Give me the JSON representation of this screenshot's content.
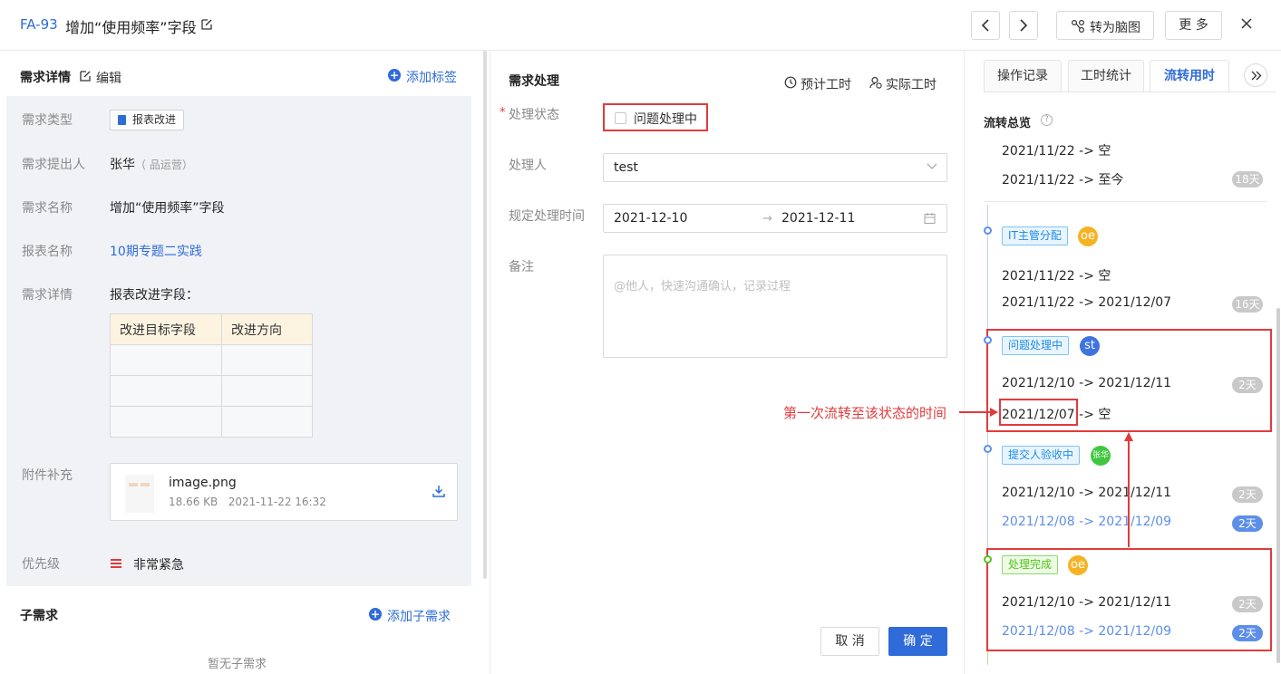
{
  "header": {
    "id": "FA-93",
    "title": "增加“使用频率”字段",
    "mind_map_label": "转为脑图",
    "more_label": "更 多"
  },
  "left": {
    "section_title": "需求详情",
    "edit_label": "编辑",
    "add_tag_label": "添加标签",
    "fields": {
      "type_label": "需求类型",
      "type_value": "报表改进",
      "requester_label": "需求提出人",
      "requester_value": "张华",
      "requester_dept": "（ 品运营）",
      "name_label": "需求名称",
      "name_value": "增加“使用频率”字段",
      "report_label": "报表名称",
      "report_value": "10期专题二实践",
      "detail_label": "需求详情",
      "detail_value": "报表改进字段：",
      "attach_label": "附件补充",
      "priority_label": "优先级",
      "priority_value": "非常紧急"
    },
    "table": {
      "headers": [
        "改进目标字段",
        "改进方向"
      ]
    },
    "attachment": {
      "file_name": "image.png",
      "size": "18.66 KB",
      "time": "2021-11-22 16:32"
    },
    "sub_title": "子需求",
    "add_sub_label": "添加子需求",
    "empty_text": "暂无子需求"
  },
  "middle": {
    "section_title": "需求处理",
    "estimate_label": "预计工时",
    "actual_label": "实际工时",
    "status_label": "处理状态",
    "status_value": "问题处理中",
    "handler_label": "处理人",
    "handler_value": "test",
    "deadline_label": "规定处理时间",
    "date_start": "2021-12-10",
    "date_end": "2021-12-11",
    "note_label": "备注",
    "note_placeholder": "@他人，快速沟通确认，记录过程",
    "cancel_label": "取 消",
    "ok_label": "确 定"
  },
  "right": {
    "tabs": [
      "操作记录",
      "工时统计",
      "流转用时"
    ],
    "active_tab": "流转用时",
    "overview_title": "流转总览",
    "summary": [
      {
        "text": "2021/11/22 -> 空"
      },
      {
        "text": "2021/11/22 -> 至今",
        "duration": "18天"
      }
    ],
    "stages": [
      {
        "tag": "IT主管分配",
        "avatar": "oe",
        "rows": [
          {
            "text": "2021/11/22 -> 空"
          },
          {
            "text": "2021/11/22 -> 2021/12/07",
            "duration": "16天"
          }
        ]
      },
      {
        "tag": "问题处理中",
        "avatar": "st",
        "rows": [
          {
            "text": "2021/12/10 -> 2021/12/11",
            "duration": "2天"
          },
          {
            "date": "2021/12/07",
            "rest": "-> 空"
          }
        ]
      },
      {
        "tag": "提交人验收中",
        "avatar": "张华",
        "rows": [
          {
            "text": "2021/12/10 -> 2021/12/11",
            "duration": "2天"
          },
          {
            "text": "2021/12/08 -> 2021/12/09",
            "duration": "2天"
          }
        ]
      },
      {
        "tag": "处理完成",
        "avatar": "oe",
        "rows": [
          {
            "text": "2021/12/10 -> 2021/12/11",
            "duration": "2天"
          },
          {
            "text": "2021/12/08 -> 2021/12/09",
            "duration": "2天"
          }
        ]
      }
    ]
  },
  "annotation": "第一次流转至该状态的时间",
  "colors": {
    "accent": "#2f6bd9",
    "highlight_red": "#e23b3b",
    "tag_blue": "#1f8ae6",
    "tag_green": "#52c41a"
  }
}
